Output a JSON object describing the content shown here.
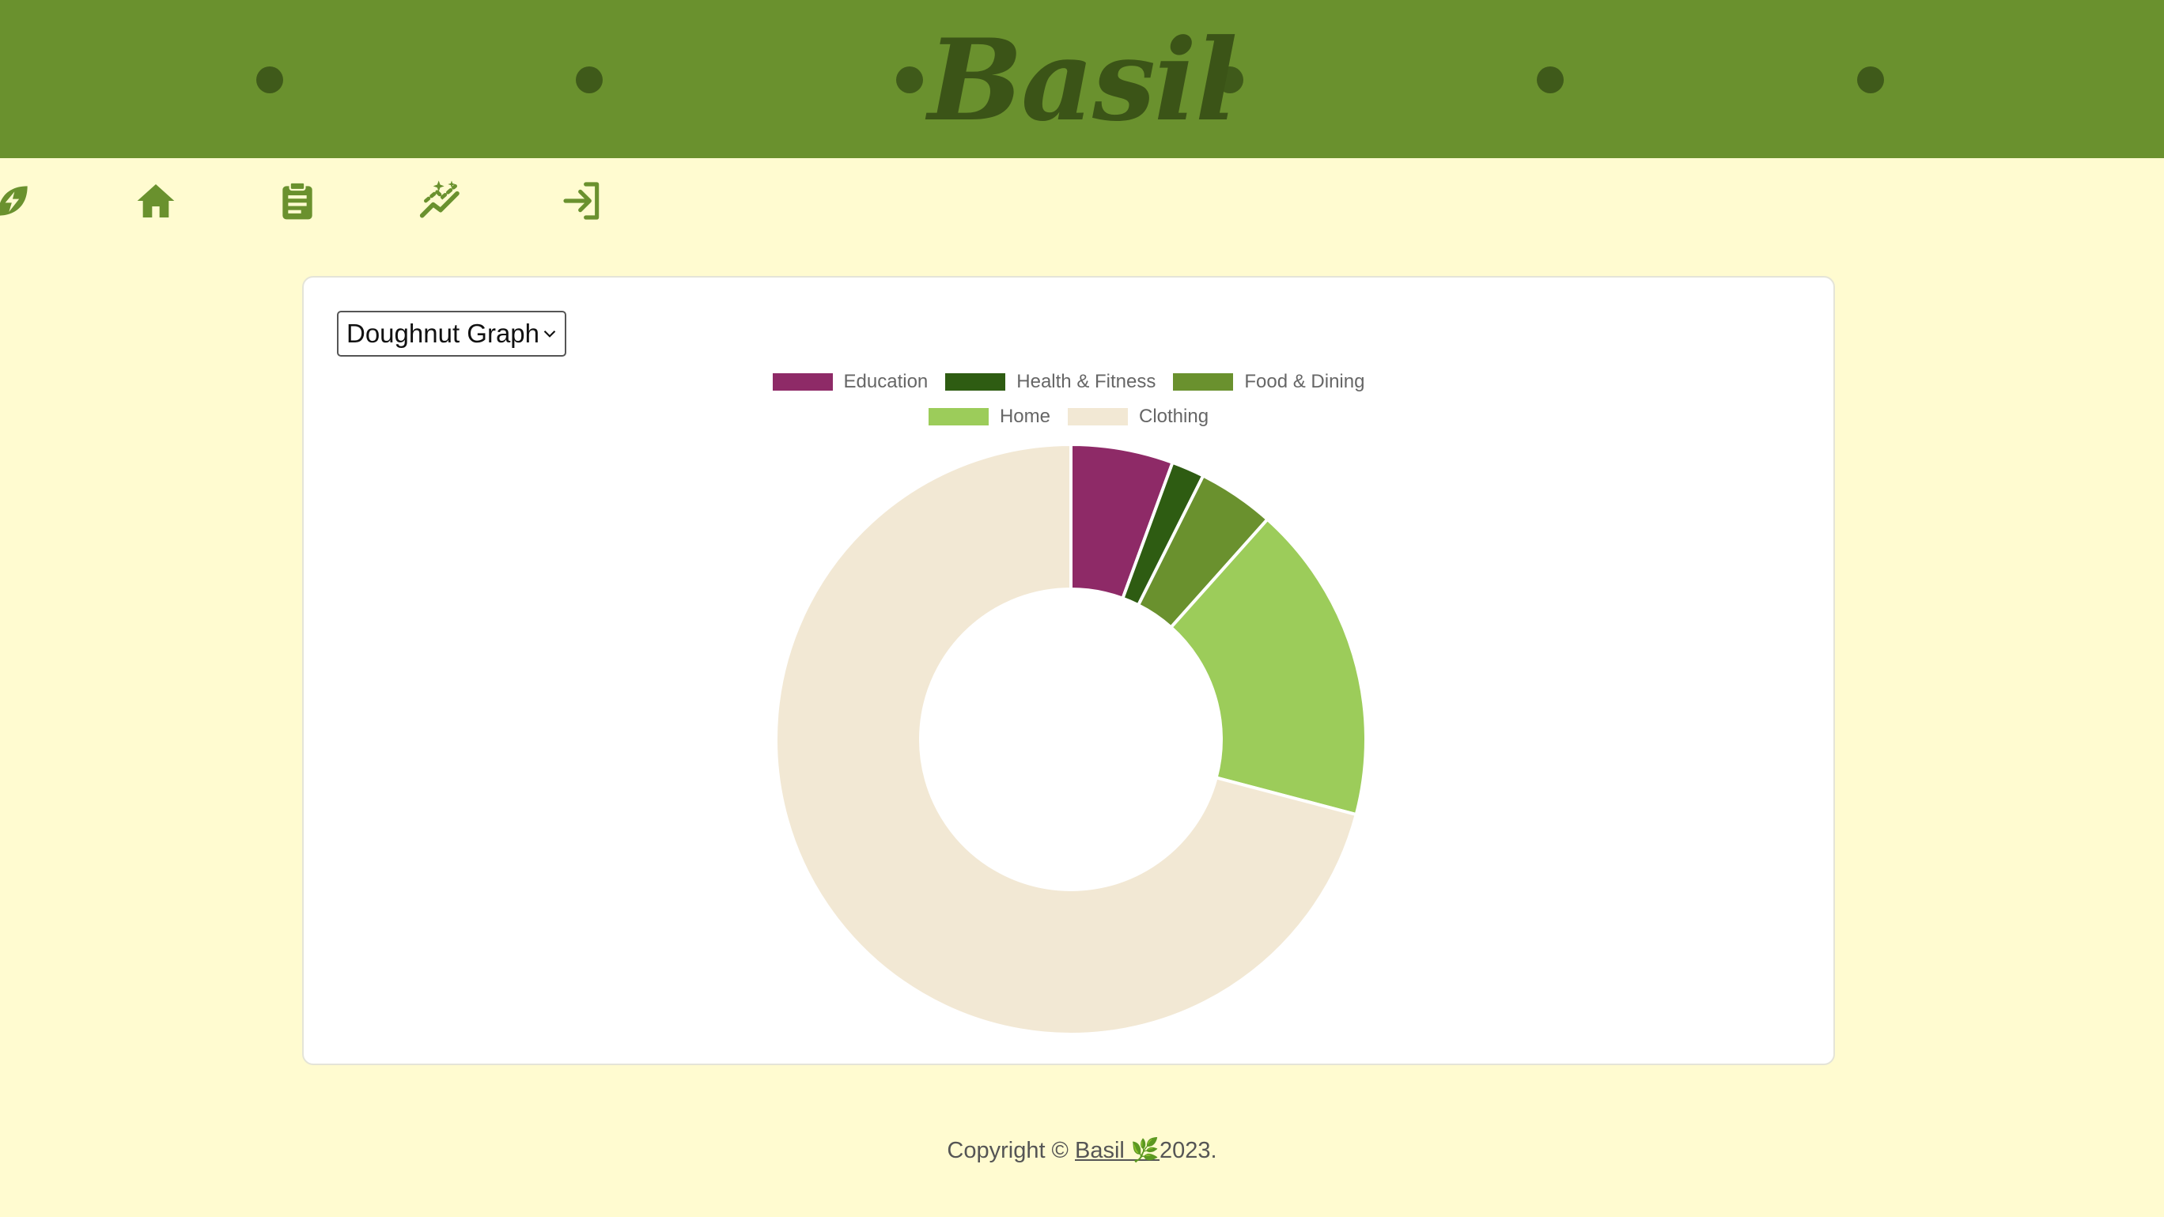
{
  "header": {
    "brand": "Basil",
    "background": "#6a912e",
    "dot_color": "#3f5a1a"
  },
  "nav": {
    "items": [
      {
        "icon": "leaf-bolt-icon"
      },
      {
        "icon": "home-icon"
      },
      {
        "icon": "clipboard-icon"
      },
      {
        "icon": "sparkle-chart-icon"
      },
      {
        "icon": "sign-in-icon"
      }
    ],
    "icon_color": "#6a912e"
  },
  "graph_select": {
    "selected": "Doughnut Graph"
  },
  "chart_data": {
    "type": "doughnut",
    "legend_position": "top",
    "categories": [
      "Education",
      "Health & Fitness",
      "Food & Dining",
      "Home",
      "Clothing"
    ],
    "values": [
      5.6,
      1.8,
      4.2,
      17.5,
      70.9
    ],
    "colors": [
      "#8e2a67",
      "#2e5c12",
      "#6a912e",
      "#9ccc5a",
      "#f2e8d4"
    ]
  },
  "footer": {
    "prefix": "Copyright © ",
    "link_text": "Basil 🌿",
    "suffix": "2023."
  }
}
